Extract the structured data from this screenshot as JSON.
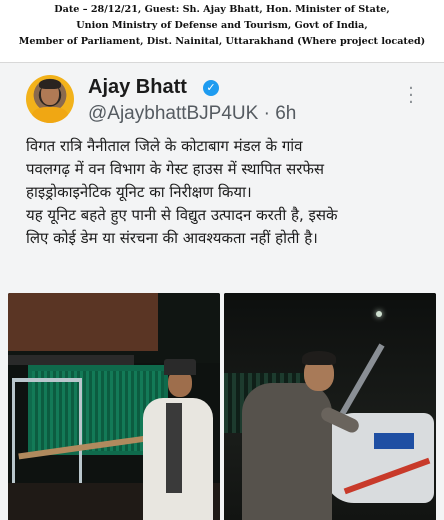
{
  "caption": {
    "line1": "Date – 28/12/21, Guest: Sh. Ajay Bhatt, Hon. Minister of State,",
    "line2": "Union Ministry of Defense and Tourism, Govt of India,",
    "line3": "Member of Parliament, Dist. Nainital, Uttarakhand (Where project located)"
  },
  "post": {
    "display_name": "Ajay Bhatt",
    "verified_icon": "verified-badge-icon",
    "handle": "@AjaybhattBJP4UK",
    "separator": "·",
    "time": "6h",
    "more_icon": "more-options-icon",
    "text_lines": [
      "विगत रात्रि नैनीताल जिले के कोटाबाग मंडल के गांव",
      "पवलगढ़ में वन विभाग के गेस्ट हाउस में स्थापित सरफेस",
      "हाइड्रोकाइनेटिक यूनिट का निरीक्षण किया।",
      "यह यूनिट बहते हुए पानी से विद्युत उत्पादन करती है, इसके",
      "लिए कोई डेम या संरचना की आवश्यकता नहीं होती है।"
    ]
  },
  "colors": {
    "verified_blue": "#1d9bf0",
    "background": "#f3f4f5"
  }
}
